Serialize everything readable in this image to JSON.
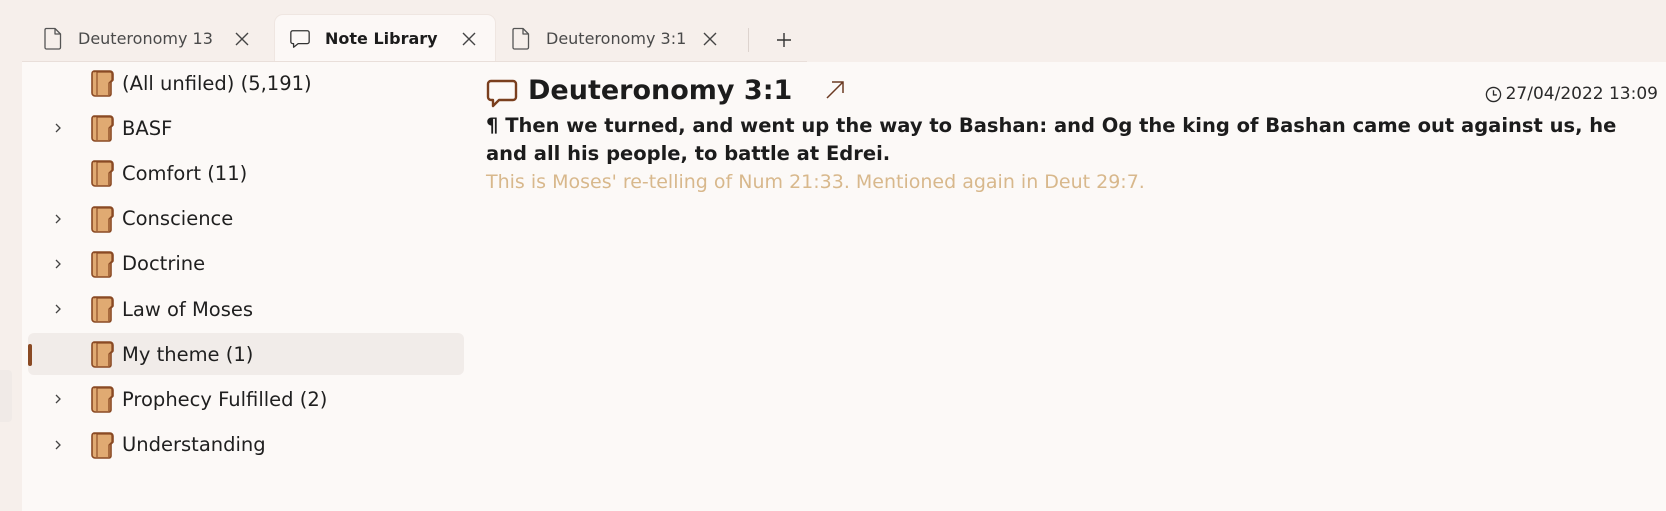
{
  "tabs": [
    {
      "label": "Deuteronomy 13",
      "icon": "document-icon",
      "active": false
    },
    {
      "label": "Note Library",
      "icon": "speech-bubble-icon",
      "active": true
    },
    {
      "label": "Deuteronomy 3:1",
      "icon": "document-icon",
      "active": false
    }
  ],
  "new_tab_label": "+",
  "sidebar": {
    "items": [
      {
        "label": "(All unfiled) (5,191)",
        "expandable": false,
        "selected": false
      },
      {
        "label": "BASF",
        "expandable": true,
        "selected": false
      },
      {
        "label": "Comfort (11)",
        "expandable": false,
        "selected": false
      },
      {
        "label": "Conscience",
        "expandable": true,
        "selected": false
      },
      {
        "label": "Doctrine",
        "expandable": true,
        "selected": false
      },
      {
        "label": "Law of Moses",
        "expandable": true,
        "selected": false
      },
      {
        "label": "My theme (1)",
        "expandable": false,
        "selected": true
      },
      {
        "label": "Prophecy Fulfilled (2)",
        "expandable": true,
        "selected": false
      },
      {
        "label": "Understanding",
        "expandable": true,
        "selected": false
      }
    ]
  },
  "note": {
    "title": "Deuteronomy 3:1",
    "timestamp": "27/04/2022 13:09",
    "verse_text": "¶ Then we turned, and went up the way to Bashan: and Og the king of Bashan came out against us, he and all his people, to battle at Edrei.",
    "comment": "This is Moses' re-telling of Num 21:33.  Mentioned again in Deut 29:7."
  },
  "colors": {
    "accent": "#8a4a24",
    "comment": "#d8b88c",
    "book_fill": "#e0aa72",
    "book_stroke": "#8a4a24"
  }
}
